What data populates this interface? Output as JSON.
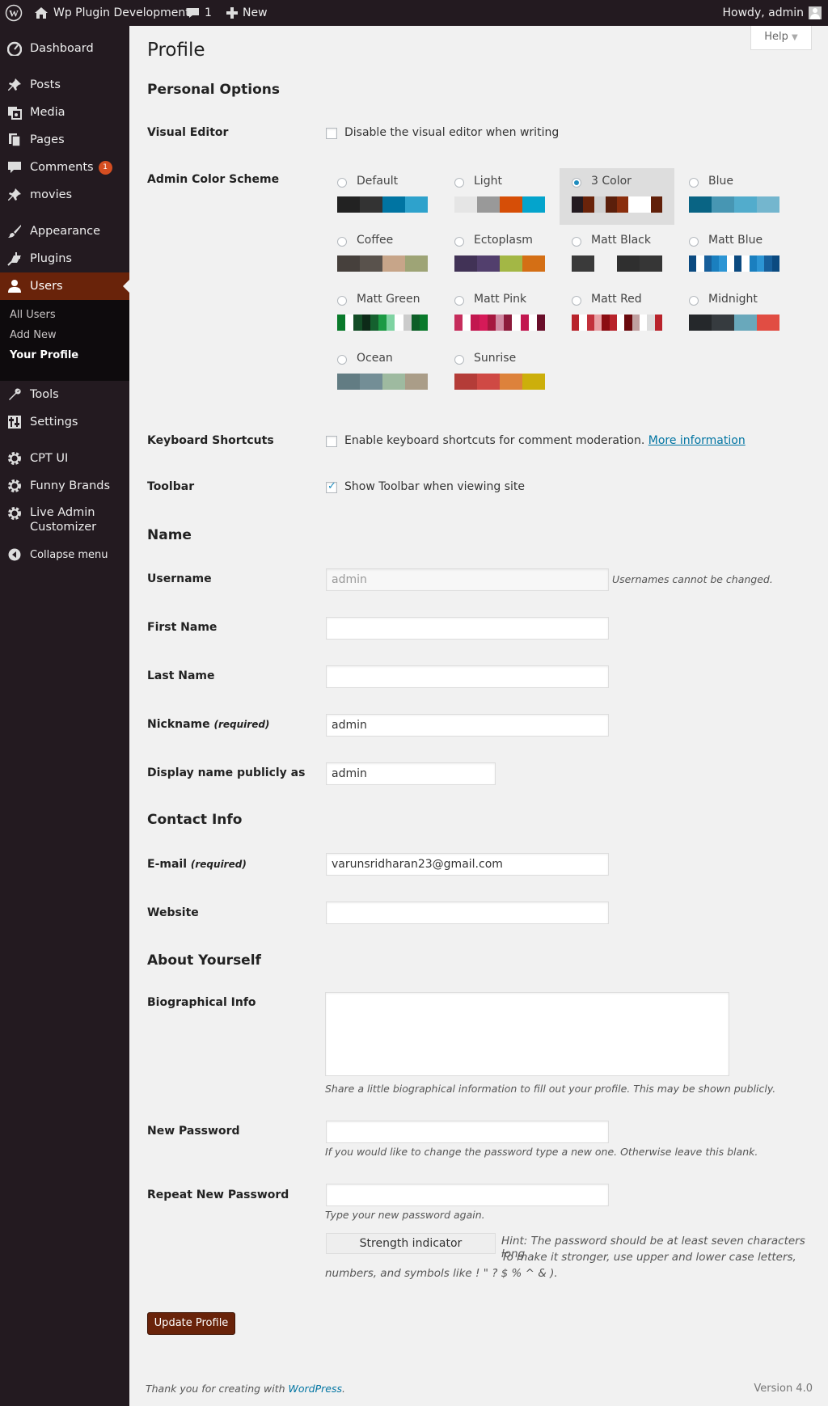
{
  "adminbar": {
    "site_name": "Wp Plugin Development",
    "comments_count": "1",
    "new_label": "New",
    "howdy": "Howdy, admin"
  },
  "sidebar": {
    "dashboard": "Dashboard",
    "posts": "Posts",
    "media": "Media",
    "pages": "Pages",
    "comments": "Comments",
    "comments_badge": "1",
    "movies": "movies",
    "appearance": "Appearance",
    "plugins": "Plugins",
    "users": "Users",
    "sub_all_users": "All Users",
    "sub_add_new": "Add New",
    "sub_your_profile": "Your Profile",
    "tools": "Tools",
    "settings": "Settings",
    "cpt_ui": "CPT UI",
    "funny_brands": "Funny Brands",
    "live_admin_1": "Live Admin",
    "live_admin_2": "Customizer",
    "collapse": "Collapse menu"
  },
  "help_tab": "Help",
  "page_title": "Profile",
  "sections": {
    "personal_options": "Personal Options",
    "name": "Name",
    "contact_info": "Contact Info",
    "about_yourself": "About Yourself"
  },
  "visual_editor": {
    "label": "Visual Editor",
    "checkbox_label": "Disable the visual editor when writing",
    "checked": false
  },
  "color_scheme": {
    "label": "Admin Color Scheme",
    "selected": "3 Color",
    "schemes": [
      {
        "name": "Default",
        "colors": [
          "#222222",
          "#333333",
          "#0074a2",
          "#2ea2cc"
        ]
      },
      {
        "name": "Light",
        "colors": [
          "#e5e5e5",
          "#999999",
          "#d64e07",
          "#04a4cc"
        ]
      },
      {
        "name": "3 Color",
        "colors": [
          "#231a20",
          "#69230a",
          "#d0d0d0",
          "#5b1f0b",
          "#8a2e0d",
          "#ffffff",
          "#ffffff",
          "#61200a"
        ]
      },
      {
        "name": "Blue",
        "colors": [
          "#096484",
          "#4796b3",
          "#52accc",
          "#74b6ce"
        ]
      },
      {
        "name": "Coffee",
        "colors": [
          "#46403c",
          "#59524c",
          "#c7a589",
          "#9ea476"
        ]
      },
      {
        "name": "Ectoplasm",
        "colors": [
          "#413256",
          "#523f6d",
          "#a3b745",
          "#d46f15"
        ]
      },
      {
        "name": "Matt Black",
        "colors": [
          "#3a3a3a",
          "#f1f1f1",
          "#2f2f2f",
          "#363636"
        ]
      },
      {
        "name": "Matt Blue",
        "colors": [
          "#0b4a80",
          "#ffffff",
          "#175f9b",
          "#1a7fbf",
          "#2c95d4",
          "#ffffff",
          "#0b4a80",
          "#ffffff",
          "#1a7fbf",
          "#2c95d4",
          "#175f9b",
          "#0b4a80"
        ]
      },
      {
        "name": "Matt Green",
        "colors": [
          "#0a7a2b",
          "#ffffff",
          "#144d27",
          "#0d2a18",
          "#15612f",
          "#1c9a44",
          "#7fd3a2",
          "#ffffff",
          "#cccccc",
          "#0d5e27",
          "#0a7a2b"
        ]
      },
      {
        "name": "Matt Pink",
        "colors": [
          "#c62d5c",
          "#ffffff",
          "#c2174f",
          "#d61a58",
          "#a6173f",
          "#d18aa3",
          "#8c1a3b",
          "#ffffff",
          "#c2174f",
          "#ffffff",
          "#6a0e2a"
        ]
      },
      {
        "name": "Matt Red",
        "colors": [
          "#b8232b",
          "#ffffff",
          "#c2313b",
          "#e8a0a4",
          "#8b0d12",
          "#b8232b",
          "#ffffff",
          "#6b0a0e",
          "#c0a0a0",
          "#ffffff",
          "#dddddd",
          "#b8232b"
        ]
      },
      {
        "name": "Midnight",
        "colors": [
          "#25282b",
          "#363b3f",
          "#69a8bb",
          "#e14d43"
        ]
      },
      {
        "name": "Ocean",
        "colors": [
          "#627c83",
          "#738e96",
          "#9ebaa0",
          "#aa9d88"
        ]
      },
      {
        "name": "Sunrise",
        "colors": [
          "#b43c38",
          "#cf4944",
          "#dd823b",
          "#ccaf0b"
        ]
      }
    ]
  },
  "keyboard_shortcuts": {
    "label": "Keyboard Shortcuts",
    "checkbox_label": "Enable keyboard shortcuts for comment moderation.",
    "more_info": "More information",
    "checked": false
  },
  "toolbar": {
    "label": "Toolbar",
    "checkbox_label": "Show Toolbar when viewing site",
    "checked": true
  },
  "fields": {
    "username_label": "Username",
    "username_value": "admin",
    "username_note": "Usernames cannot be changed.",
    "first_name_label": "First Name",
    "first_name_value": "",
    "last_name_label": "Last Name",
    "last_name_value": "",
    "nickname_label": "Nickname",
    "nickname_required": "(required)",
    "nickname_value": "admin",
    "display_name_label": "Display name publicly as",
    "display_name_value": "admin",
    "email_label": "E-mail",
    "email_required": "(required)",
    "email_value": "varunsridharan23@gmail.com",
    "website_label": "Website",
    "website_value": "",
    "bio_label": "Biographical Info",
    "bio_value": "",
    "bio_desc": "Share a little biographical information to fill out your profile. This may be shown publicly.",
    "new_password_label": "New Password",
    "new_password_desc": "If you would like to change the password type a new one. Otherwise leave this blank.",
    "repeat_password_label": "Repeat New Password",
    "repeat_password_desc": "Type your new password again.",
    "strength_indicator": "Strength indicator",
    "hint_line1": "Hint: The password should be at least seven characters long.",
    "hint_line2": "To make it stronger, use upper and lower case letters,",
    "hint_line3": "numbers, and symbols like ! \" ? $ % ^ & )."
  },
  "update_button": "Update Profile",
  "footer": {
    "thanks": "Thank you for creating with",
    "wp_link": "WordPress",
    "dot": ".",
    "version": "Version 4.0"
  }
}
